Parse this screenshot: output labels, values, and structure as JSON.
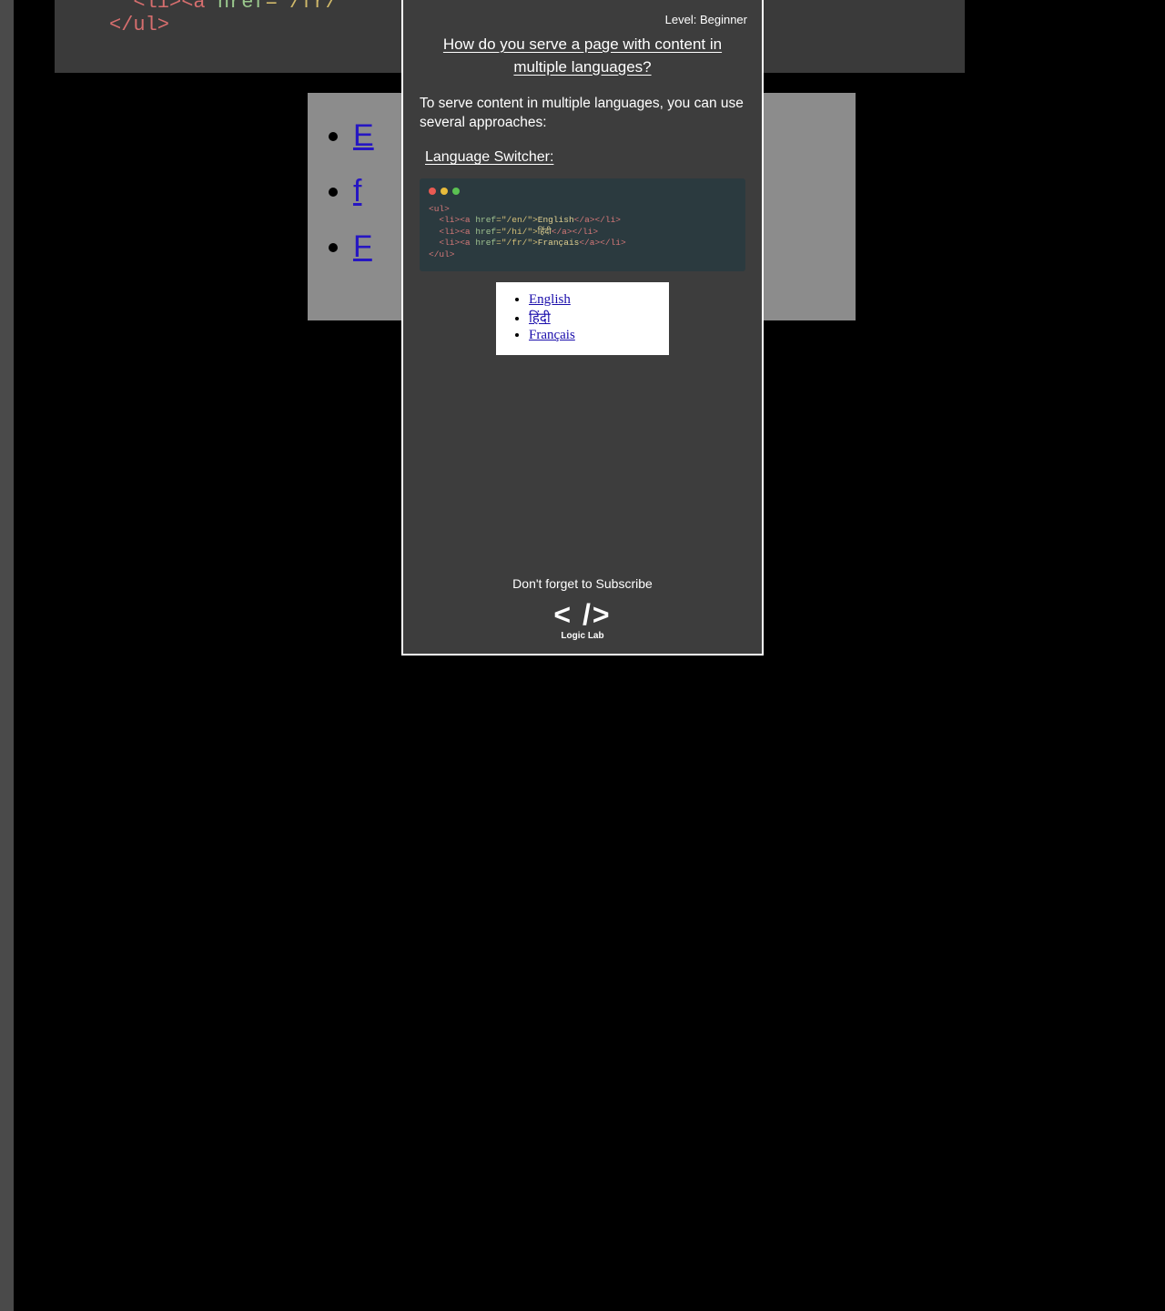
{
  "background": {
    "code_line1_pre": "<li><a",
    "code_line1_attr": "href",
    "code_line1_val": "=\"/fr/\"",
    "code_line2": "</ul>",
    "preview_items": [
      "E",
      "f",
      "F"
    ]
  },
  "card": {
    "level_label": "Level: Beginner",
    "title": "How do you serve a page with content in multiple languages?",
    "intro": "To serve content in multiple languages, you can use several approaches:",
    "section_title": "Language Switcher:",
    "code_lines": [
      {
        "indent": "",
        "open": "<ul>",
        "attr": "",
        "val": "",
        "text": "",
        "close": ""
      },
      {
        "indent": "  ",
        "open": "<li><a",
        "attr": " href",
        "val": "=\"/en/\">",
        "text": "English",
        "close": "</a></li>"
      },
      {
        "indent": "  ",
        "open": "<li><a",
        "attr": " href",
        "val": "=\"/hi/\">",
        "text": "हिंदी",
        "close": "</a></li>"
      },
      {
        "indent": "  ",
        "open": "<li><a",
        "attr": " href",
        "val": "=\"/fr/\">",
        "text": "Français",
        "close": "</a></li>"
      },
      {
        "indent": "",
        "open": "</ul>",
        "attr": "",
        "val": "",
        "text": "",
        "close": ""
      }
    ],
    "preview_links": [
      "English",
      "हिंदी",
      "Français"
    ],
    "subscribe": "Don't forget to Subscribe",
    "logo": "< />",
    "brand": "Logic Lab"
  }
}
